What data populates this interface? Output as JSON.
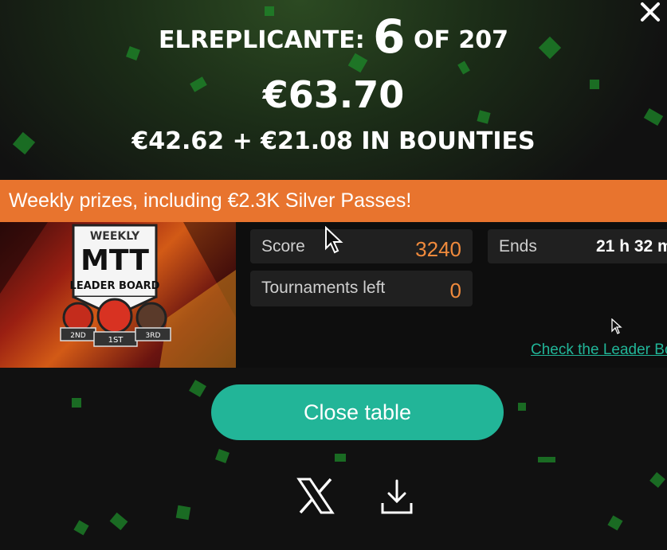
{
  "result": {
    "player": "ELREPLICANTE:",
    "position": "6",
    "of_label": "OF 207",
    "total_prize": "€63.70",
    "breakdown": "€42.62 + €21.08 IN BOUNTIES"
  },
  "promo": {
    "banner": "Weekly prizes, including €2.3K Silver Passes!",
    "image_text": {
      "weekly": "WEEKLY",
      "mtt": "MTT",
      "leader_board": "LEADER BOARD",
      "ranks": [
        "2ND",
        "1ST",
        "3RD"
      ]
    },
    "score_label": "Score",
    "score_value": "3240",
    "tournaments_label": "Tournaments left",
    "tournaments_value": "0",
    "ends_label": "Ends",
    "ends_value": "21 h 32 m",
    "link": "Check the Leader Board"
  },
  "buttons": {
    "close_table": "Close table"
  },
  "colors": {
    "accent": "#22b598",
    "banner": "#e8742e",
    "value_orange": "#f08a3c",
    "confetti": "#1e8a2a"
  },
  "icons": [
    "close-icon",
    "x-share-icon",
    "download-icon",
    "cursor-icon"
  ]
}
